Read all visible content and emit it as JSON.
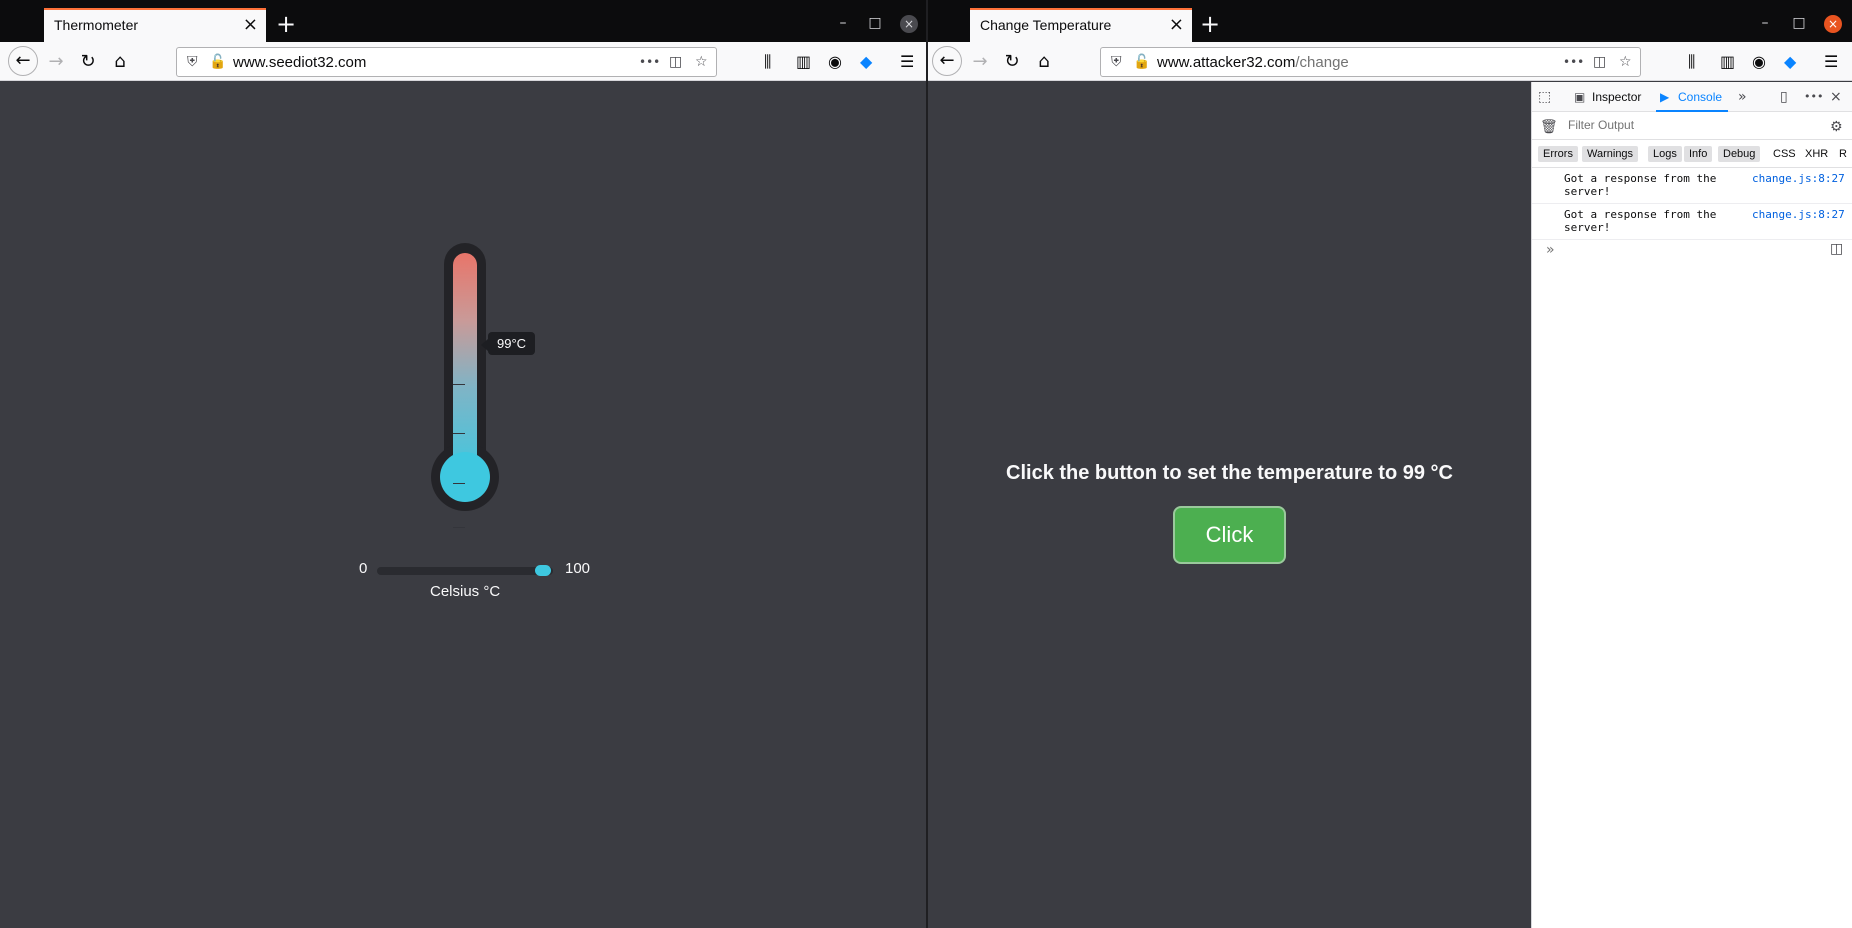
{
  "left_window": {
    "tab_title": "Thermometer",
    "url": "www.seediot32.com",
    "thermometer": {
      "reading": "99°C",
      "value": 99,
      "slider_min": "0",
      "slider_max": "100",
      "unit_label": "Celsius °C"
    }
  },
  "right_window": {
    "tab_title": "Change Temperature",
    "url_host": "www.attacker32.com",
    "url_path": "/change",
    "heading": "Click the button to set the temperature to 99 °C",
    "button_label": "Click",
    "devtools": {
      "tabs": [
        "Inspector",
        "Console"
      ],
      "active_tab": "Console",
      "filter_placeholder": "Filter Output",
      "levels": [
        "Errors",
        "Warnings",
        "Logs",
        "Info",
        "Debug"
      ],
      "types": [
        "CSS",
        "XHR",
        "R"
      ],
      "messages": [
        {
          "text": "Got a response from the server!",
          "source": "change.js:8:27"
        },
        {
          "text": "Got a response from the server!",
          "source": "change.js:8:27"
        }
      ]
    }
  },
  "icons": {
    "new_tab": "+",
    "close": "×",
    "minimize": "–",
    "maximize": "□",
    "back": "←",
    "forward": "→",
    "reload": "↻",
    "home": "⌂",
    "more": "•••",
    "menu": "☰",
    "prompt": "»"
  },
  "colors": {
    "accent_tab": "#ff7139",
    "console_active": "#0a84ff",
    "button_green": "#4caf50",
    "thermo_cool": "#3ec8e0",
    "thermo_hot": "#e8756a",
    "close_red": "#e95420"
  }
}
